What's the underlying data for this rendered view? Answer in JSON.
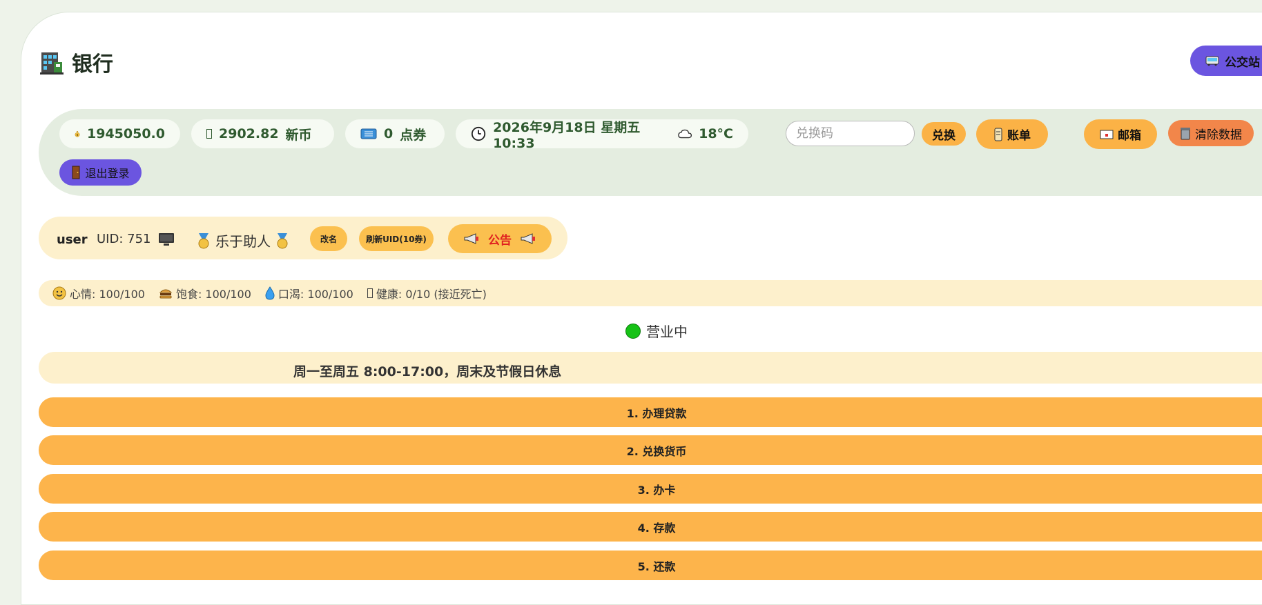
{
  "page": {
    "title": "银行",
    "bus_button_label": "公交站"
  },
  "status": {
    "money": "1945050.0",
    "new_coin_value": "2902.82",
    "new_coin_unit": "新币",
    "coupon_value": "0",
    "coupon_unit": "点券",
    "datetime": "2026年9月18日 星期五 10:33",
    "temperature": "18°C",
    "redeem_placeholder": "兑换码",
    "redeem_button": "兑换",
    "bill_button": "账单",
    "mail_button": "邮箱",
    "clear_button": "清除数据",
    "logout_button": "退出登录"
  },
  "user": {
    "name": "user",
    "uid": "UID: 751",
    "title": "乐于助人",
    "rename_button": "改名",
    "refresh_uid_button": "刷新UID(10券)",
    "announcement_button": "公告"
  },
  "stats": [
    {
      "icon": "smile-icon",
      "text": "心情: 100/100"
    },
    {
      "icon": "burger-icon",
      "text": "饱食: 100/100"
    },
    {
      "icon": "droplet-icon",
      "text": "口渴: 100/100"
    },
    {
      "icon": "health-icon",
      "text": "健康: 0/10 (接近死亡)"
    }
  ],
  "bank": {
    "open_status": "营业中",
    "hours": "周一至周五 8:00-17:00，周末及节假日休息",
    "menu": [
      "1. 办理贷款",
      "2. 兑换货币",
      "3. 办卡",
      "4. 存款",
      "5. 还款"
    ]
  },
  "colors": {
    "accent_purple": "#6b55e0",
    "accent_orange": "#fdb44b",
    "open_green": "#16c216"
  }
}
